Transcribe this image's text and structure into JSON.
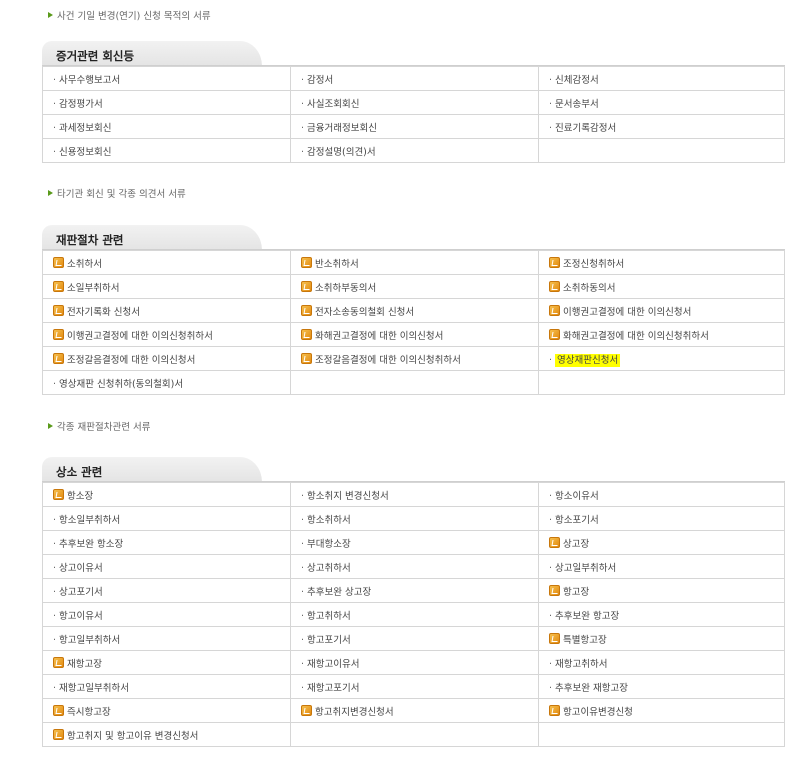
{
  "notes": {
    "top": "사건 기일 변경(연기) 신청 목적의 서류",
    "evidence": "타기관 회신 및 각종 의견서 서류",
    "trial": "각종 재판절차관련 서류"
  },
  "sections": {
    "evidence": {
      "title": "증거관련 회신등",
      "rows": [
        [
          {
            "text": "사무수행보고서",
            "type": "dot"
          },
          {
            "text": "감정서",
            "type": "dot"
          },
          {
            "text": "신체감정서",
            "type": "dot"
          }
        ],
        [
          {
            "text": "감정평가서",
            "type": "dot"
          },
          {
            "text": "사실조회회신",
            "type": "dot"
          },
          {
            "text": "문서송부서",
            "type": "dot"
          }
        ],
        [
          {
            "text": "과세정보회신",
            "type": "dot"
          },
          {
            "text": "금융거래정보회신",
            "type": "dot"
          },
          {
            "text": "진료기록감정서",
            "type": "dot"
          }
        ],
        [
          {
            "text": "신용정보회신",
            "type": "dot"
          },
          {
            "text": "감정설명(의견)서",
            "type": "dot"
          },
          {
            "text": "",
            "type": "empty"
          }
        ]
      ]
    },
    "trial": {
      "title": "재판절차 관련",
      "rows": [
        [
          {
            "text": "소취하서",
            "type": "icon"
          },
          {
            "text": "반소취하서",
            "type": "icon"
          },
          {
            "text": "조정신청취하서",
            "type": "icon"
          }
        ],
        [
          {
            "text": "소일부취하서",
            "type": "icon"
          },
          {
            "text": "소취하부동의서",
            "type": "icon"
          },
          {
            "text": "소취하동의서",
            "type": "icon"
          }
        ],
        [
          {
            "text": "전자기록화 신청서",
            "type": "icon"
          },
          {
            "text": "전자소송동의철회 신청서",
            "type": "icon"
          },
          {
            "text": "이행권고결정에 대한 이의신청서",
            "type": "icon"
          }
        ],
        [
          {
            "text": "이행권고결정에 대한 이의신청취하서",
            "type": "icon"
          },
          {
            "text": "화해권고결정에 대한 이의신청서",
            "type": "icon"
          },
          {
            "text": "화해권고결정에 대한 이의신청취하서",
            "type": "icon"
          }
        ],
        [
          {
            "text": "조정갈음결정에 대한 이의신청서",
            "type": "icon"
          },
          {
            "text": "조정갈음결정에 대한 이의신청취하서",
            "type": "icon"
          },
          {
            "text": "영상재판신청서",
            "type": "highlight"
          }
        ],
        [
          {
            "text": "영상재판 신청취하(동의철회)서",
            "type": "dot"
          },
          {
            "text": "",
            "type": "empty"
          },
          {
            "text": "",
            "type": "empty"
          }
        ]
      ]
    },
    "appeal": {
      "title": "상소 관련",
      "rows": [
        [
          {
            "text": "항소장",
            "type": "icon"
          },
          {
            "text": "항소취지 변경신청서",
            "type": "dot"
          },
          {
            "text": "항소이유서",
            "type": "dot"
          }
        ],
        [
          {
            "text": "항소일부취하서",
            "type": "dot"
          },
          {
            "text": "항소취하서",
            "type": "dot"
          },
          {
            "text": "항소포기서",
            "type": "dot"
          }
        ],
        [
          {
            "text": "추후보완 항소장",
            "type": "dot"
          },
          {
            "text": "부대항소장",
            "type": "dot"
          },
          {
            "text": "상고장",
            "type": "icon"
          }
        ],
        [
          {
            "text": "상고이유서",
            "type": "dot"
          },
          {
            "text": "상고취하서",
            "type": "dot"
          },
          {
            "text": "상고일부취하서",
            "type": "dot"
          }
        ],
        [
          {
            "text": "상고포기서",
            "type": "dot"
          },
          {
            "text": "추후보완 상고장",
            "type": "dot"
          },
          {
            "text": "항고장",
            "type": "icon"
          }
        ],
        [
          {
            "text": "항고이유서",
            "type": "dot"
          },
          {
            "text": "항고취하서",
            "type": "dot"
          },
          {
            "text": "추후보완 항고장",
            "type": "dot"
          }
        ],
        [
          {
            "text": "항고일부취하서",
            "type": "dot"
          },
          {
            "text": "항고포기서",
            "type": "dot"
          },
          {
            "text": "특별항고장",
            "type": "icon"
          }
        ],
        [
          {
            "text": "재항고장",
            "type": "icon"
          },
          {
            "text": "재항고이유서",
            "type": "dot"
          },
          {
            "text": "재항고취하서",
            "type": "dot"
          }
        ],
        [
          {
            "text": "재항고일부취하서",
            "type": "dot"
          },
          {
            "text": "재항고포기서",
            "type": "dot"
          },
          {
            "text": "추후보완 재항고장",
            "type": "dot"
          }
        ],
        [
          {
            "text": "즉시항고장",
            "type": "icon"
          },
          {
            "text": "항고취지변경신청서",
            "type": "icon"
          },
          {
            "text": "항고이유변경신청",
            "type": "icon"
          }
        ],
        [
          {
            "text": "항고취지 및 항고이유 변경신청서",
            "type": "icon"
          },
          {
            "text": "",
            "type": "empty"
          },
          {
            "text": "",
            "type": "empty"
          }
        ]
      ]
    }
  }
}
